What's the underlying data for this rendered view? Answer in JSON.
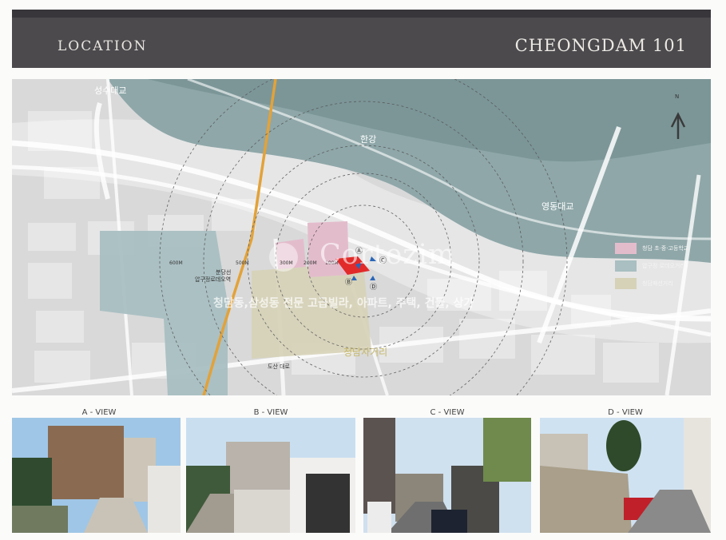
{
  "header": {
    "left_title": "LOCATION",
    "right_title": "CHEONGDAM 101"
  },
  "map": {
    "labels": {
      "bridge_top": "성수대교",
      "river": "한강",
      "bridge_right": "영동대교",
      "intersection": "청담사거리",
      "road": "도산 대로",
      "station_line1": "분당선",
      "station_line2": "압구정로데오역"
    },
    "radii": [
      "600M",
      "500M",
      "300M",
      "200M",
      "100M"
    ],
    "view_markers": [
      "Ⓐ",
      "Ⓑ",
      "Ⓒ",
      "Ⓓ"
    ],
    "compass": "N",
    "legend": [
      {
        "label": "청담 초·중·고등학교",
        "color": "#e3bccc"
      },
      {
        "label": "압구정 로데오거리",
        "color": "#a9bfc2"
      },
      {
        "label": "청담패션거리",
        "color": "#d6d2b7"
      }
    ],
    "watermark": "Cortezim",
    "tagline": "청담동,삼성동 전문 고급빌라, 아파트, 주택, 건물, 상가"
  },
  "views": [
    {
      "title": "A - VIEW"
    },
    {
      "title": "B - VIEW"
    },
    {
      "title": "C - VIEW"
    },
    {
      "title": "D - VIEW"
    }
  ]
}
